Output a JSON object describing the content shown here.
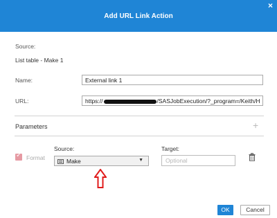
{
  "dialog": {
    "title": "Add URL Link Action",
    "close_glyph": "×"
  },
  "source": {
    "label": "Source:",
    "value": "List table - Make 1"
  },
  "name": {
    "label": "Name:",
    "value": "External link 1"
  },
  "url": {
    "label": "URL:",
    "prefix": "https://",
    "suffix": "/SASJobExecution/?_program=/Keith/H"
  },
  "parameters": {
    "title": "Parameters",
    "add_glyph": "+",
    "row": {
      "format_label": "Format",
      "format_checked": true,
      "source_label": "Source:",
      "source_value": "Make",
      "target_label": "Target:",
      "target_placeholder": "Optional"
    }
  },
  "buttons": {
    "ok": "OK",
    "cancel": "Cancel"
  },
  "colors": {
    "accent": "#1f85d6",
    "annotation_arrow": "#e01b1b"
  }
}
